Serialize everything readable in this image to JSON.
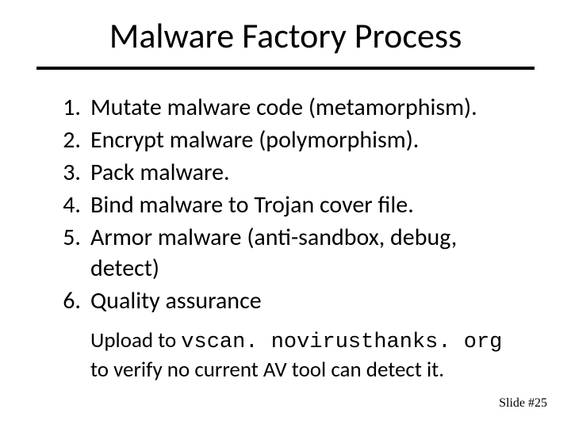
{
  "title": "Malware Factory Process",
  "items": [
    {
      "n": "1.",
      "t": "Mutate malware code (metamorphism)."
    },
    {
      "n": "2.",
      "t": "Encrypt malware (polymorphism)."
    },
    {
      "n": "3.",
      "t": "Pack malware."
    },
    {
      "n": "4.",
      "t": "Bind malware to Trojan cover file."
    },
    {
      "n": "5.",
      "t": "Armor malware (anti-sandbox, debug, detect)"
    },
    {
      "n": "6.",
      "t": "Quality assurance"
    }
  ],
  "note": {
    "pre": "Upload to ",
    "code": "vscan. novirusthanks. org ",
    "post": "to verify no current AV tool can detect it."
  },
  "footer": "Slide #25"
}
